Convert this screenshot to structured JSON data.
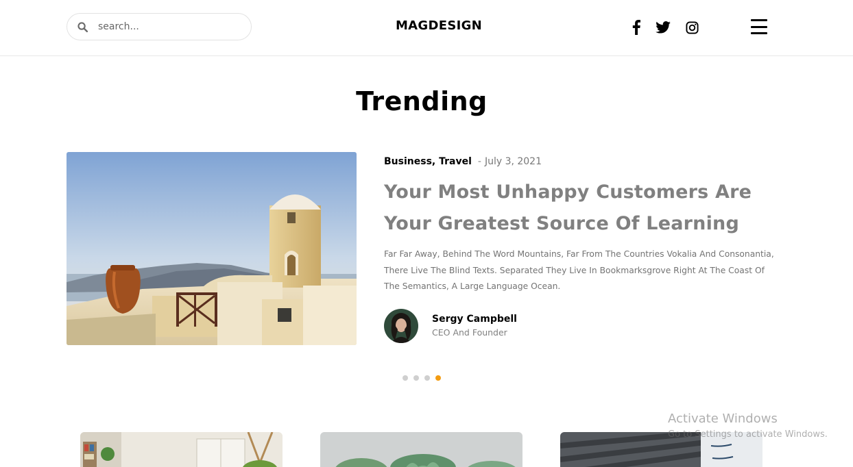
{
  "header": {
    "search_placeholder": "search...",
    "logo": "MAGDESIGN",
    "social": [
      "facebook-icon",
      "twitter-icon",
      "instagram-icon"
    ],
    "menu_icon": "hamburger-menu-icon"
  },
  "trending": {
    "title": "Trending",
    "categories": "Business, Travel",
    "separator": "-",
    "date": "July 3, 2021",
    "headline": "Your Most Unhappy Customers Are Your Greatest Source Of Learning",
    "excerpt": "Far Far Away, Behind The Word Mountains, Far From The Countries Vokalia And Consonantia, There Live The Blind Texts. Separated They Live In Bookmarksgrove Right At The Coast Of The Semantics, A Large Language Ocean.",
    "author": {
      "name": "Sergy Campbell",
      "role": "CEO And Founder"
    },
    "slides": {
      "count": 4,
      "active_index": 3
    }
  },
  "colors": {
    "accent": "#f39c12",
    "headline": "#808080",
    "dot_inactive": "#cfcfcf"
  },
  "watermark": {
    "title": "Activate Windows",
    "subtitle": "Go to Settings to activate Windows."
  }
}
